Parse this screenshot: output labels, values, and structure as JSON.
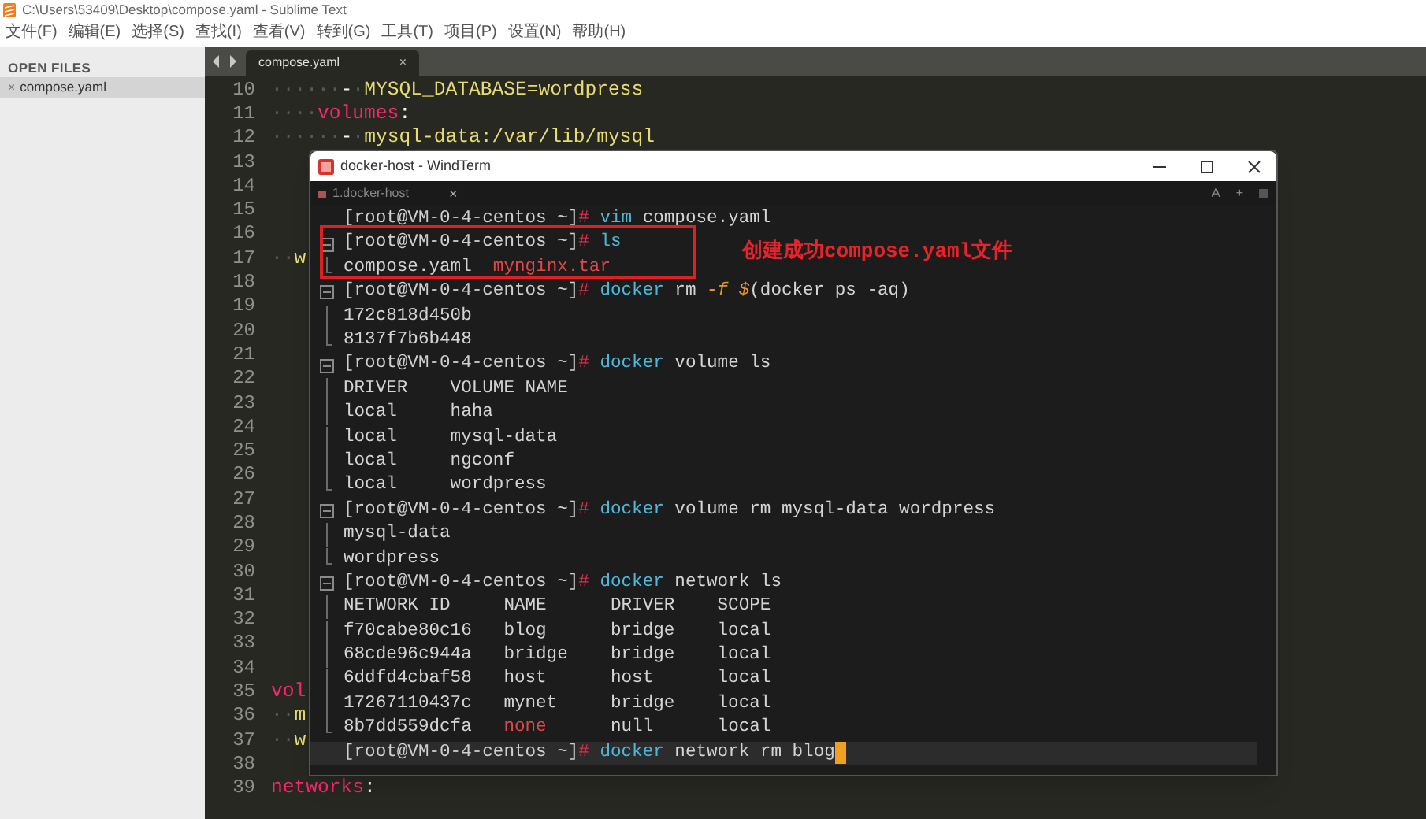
{
  "window": {
    "title": "C:\\Users\\53409\\Desktop\\compose.yaml - Sublime Text"
  },
  "menu": [
    "文件(F)",
    "编辑(E)",
    "选择(S)",
    "查找(I)",
    "查看(V)",
    "转到(G)",
    "工具(T)",
    "项目(P)",
    "设置(N)",
    "帮助(H)"
  ],
  "sidebar": {
    "header": "OPEN FILES",
    "files": [
      {
        "name": "compose.yaml",
        "close": "×",
        "selected": true
      }
    ]
  },
  "editor": {
    "tab": {
      "label": "compose.yaml",
      "close": "×"
    },
    "lines": [
      {
        "number": "10",
        "segments": [
          {
            "kind": "ws",
            "text": "······"
          },
          {
            "kind": "plain",
            "text": "-"
          },
          {
            "kind": "ws",
            "text": "·"
          },
          {
            "kind": "str",
            "text": "MYSQL_DATABASE=wordpress"
          }
        ]
      },
      {
        "number": "11",
        "segments": [
          {
            "kind": "ws",
            "text": "····"
          },
          {
            "kind": "key",
            "text": "volumes"
          },
          {
            "kind": "plain",
            "text": ":"
          }
        ]
      },
      {
        "number": "12",
        "segments": [
          {
            "kind": "ws",
            "text": "······"
          },
          {
            "kind": "plain",
            "text": "-"
          },
          {
            "kind": "ws",
            "text": "·"
          },
          {
            "kind": "str",
            "text": "mysql-data:/var/lib/mysql"
          }
        ]
      },
      {
        "number": "13"
      },
      {
        "number": "14"
      },
      {
        "number": "15"
      },
      {
        "number": "16"
      },
      {
        "number": "17",
        "segments": [
          {
            "kind": "ws",
            "text": "··"
          },
          {
            "kind": "str",
            "text": "w"
          }
        ]
      },
      {
        "number": "18"
      },
      {
        "number": "19"
      },
      {
        "number": "20"
      },
      {
        "number": "21"
      },
      {
        "number": "22"
      },
      {
        "number": "23"
      },
      {
        "number": "24"
      },
      {
        "number": "25"
      },
      {
        "number": "26"
      },
      {
        "number": "27"
      },
      {
        "number": "28"
      },
      {
        "number": "29"
      },
      {
        "number": "30"
      },
      {
        "number": "31"
      },
      {
        "number": "32"
      },
      {
        "number": "33"
      },
      {
        "number": "34"
      },
      {
        "number": "35",
        "segments": [
          {
            "kind": "key",
            "text": "vol"
          }
        ]
      },
      {
        "number": "36",
        "segments": [
          {
            "kind": "ws",
            "text": "··"
          },
          {
            "kind": "str",
            "text": "m"
          }
        ]
      },
      {
        "number": "37",
        "segments": [
          {
            "kind": "ws",
            "text": "··"
          },
          {
            "kind": "str",
            "text": "w"
          }
        ]
      },
      {
        "number": "38"
      },
      {
        "number": "39",
        "segments": [
          {
            "kind": "key",
            "text": "networks"
          },
          {
            "kind": "plain",
            "text": ":"
          }
        ]
      }
    ]
  },
  "terminal": {
    "title": "docker-host - WindTerm",
    "tab": {
      "label": "1.docker-host",
      "close": "×"
    },
    "tools": [
      "A",
      "+"
    ],
    "annotation": {
      "text": "创建成功compose.yaml文件"
    },
    "lines": [
      {
        "kind": "plain",
        "segments": [
          {
            "kind": "prompt",
            "text": "[root@VM-0-4-centos ~]"
          },
          {
            "kind": "hash",
            "text": "#"
          },
          {
            "kind": "cmd",
            "text": " vim"
          },
          {
            "kind": "plain",
            "text": " compose.yaml"
          }
        ]
      },
      {
        "kind": "fold-start",
        "segments": [
          {
            "kind": "prompt",
            "text": "[root@VM-0-4-centos ~]"
          },
          {
            "kind": "hash",
            "text": "#"
          },
          {
            "kind": "cmd",
            "text": " ls"
          }
        ]
      },
      {
        "kind": "fold-end",
        "segments": [
          {
            "kind": "plain",
            "text": "compose.yaml  "
          },
          {
            "kind": "red",
            "text": "mynginx.tar"
          }
        ]
      },
      {
        "kind": "fold-start",
        "segments": [
          {
            "kind": "prompt",
            "text": "[root@VM-0-4-centos ~]"
          },
          {
            "kind": "hash",
            "text": "#"
          },
          {
            "kind": "cmd",
            "text": " docker"
          },
          {
            "kind": "plain",
            "text": " rm "
          },
          {
            "kind": "flag",
            "text": "-f"
          },
          {
            "kind": "flag",
            "text": " $"
          },
          {
            "kind": "plain",
            "text": "(docker ps -aq)"
          }
        ]
      },
      {
        "kind": "fold-body",
        "segments": [
          {
            "kind": "plain",
            "text": "172c818d450b"
          }
        ]
      },
      {
        "kind": "fold-end",
        "segments": [
          {
            "kind": "plain",
            "text": "8137f7b6b448"
          }
        ]
      },
      {
        "kind": "fold-start",
        "segments": [
          {
            "kind": "prompt",
            "text": "[root@VM-0-4-centos ~]"
          },
          {
            "kind": "hash",
            "text": "#"
          },
          {
            "kind": "cmd",
            "text": " docker"
          },
          {
            "kind": "plain",
            "text": " volume ls"
          }
        ]
      },
      {
        "kind": "fold-body",
        "segments": [
          {
            "kind": "plain",
            "text": "DRIVER    VOLUME NAME"
          }
        ]
      },
      {
        "kind": "fold-body",
        "segments": [
          {
            "kind": "plain",
            "text": "local     haha"
          }
        ]
      },
      {
        "kind": "fold-body",
        "segments": [
          {
            "kind": "plain",
            "text": "local     mysql-data"
          }
        ]
      },
      {
        "kind": "fold-body",
        "segments": [
          {
            "kind": "plain",
            "text": "local     ngconf"
          }
        ]
      },
      {
        "kind": "fold-end",
        "segments": [
          {
            "kind": "plain",
            "text": "local     wordpress"
          }
        ]
      },
      {
        "kind": "fold-start",
        "segments": [
          {
            "kind": "prompt",
            "text": "[root@VM-0-4-centos ~]"
          },
          {
            "kind": "hash",
            "text": "#"
          },
          {
            "kind": "cmd",
            "text": " docker"
          },
          {
            "kind": "plain",
            "text": " volume rm mysql-data wordpress"
          }
        ]
      },
      {
        "kind": "fold-body",
        "segments": [
          {
            "kind": "plain",
            "text": "mysql-data"
          }
        ]
      },
      {
        "kind": "fold-end",
        "segments": [
          {
            "kind": "plain",
            "text": "wordpress"
          }
        ]
      },
      {
        "kind": "fold-start",
        "segments": [
          {
            "kind": "prompt",
            "text": "[root@VM-0-4-centos ~]"
          },
          {
            "kind": "hash",
            "text": "#"
          },
          {
            "kind": "cmd",
            "text": " docker"
          },
          {
            "kind": "plain",
            "text": " network ls"
          }
        ]
      },
      {
        "kind": "fold-body",
        "segments": [
          {
            "kind": "plain",
            "text": "NETWORK ID     NAME      DRIVER    SCOPE"
          }
        ]
      },
      {
        "kind": "fold-body",
        "segments": [
          {
            "kind": "plain",
            "text": "f70cabe80c16   blog      bridge    local"
          }
        ]
      },
      {
        "kind": "fold-body",
        "segments": [
          {
            "kind": "plain",
            "text": "68cde96c944a   bridge    bridge    local"
          }
        ]
      },
      {
        "kind": "fold-body",
        "segments": [
          {
            "kind": "plain",
            "text": "6ddfd4cbaf58   host      host      local"
          }
        ]
      },
      {
        "kind": "fold-body",
        "segments": [
          {
            "kind": "plain",
            "text": "17267110437c   mynet     bridge    local"
          }
        ]
      },
      {
        "kind": "fold-end",
        "segments": [
          {
            "kind": "plain",
            "text": "8b7dd559dcfa   "
          },
          {
            "kind": "red",
            "text": "none"
          },
          {
            "kind": "plain",
            "text": "      null      local"
          }
        ]
      },
      {
        "kind": "plain",
        "current": true,
        "cursor": true,
        "segments": [
          {
            "kind": "prompt",
            "text": "[root@VM-0-4-centos ~]"
          },
          {
            "kind": "hash",
            "text": "#"
          },
          {
            "kind": "cmd",
            "text": " docker"
          },
          {
            "kind": "plain",
            "text": " network rm blog"
          }
        ]
      }
    ]
  }
}
